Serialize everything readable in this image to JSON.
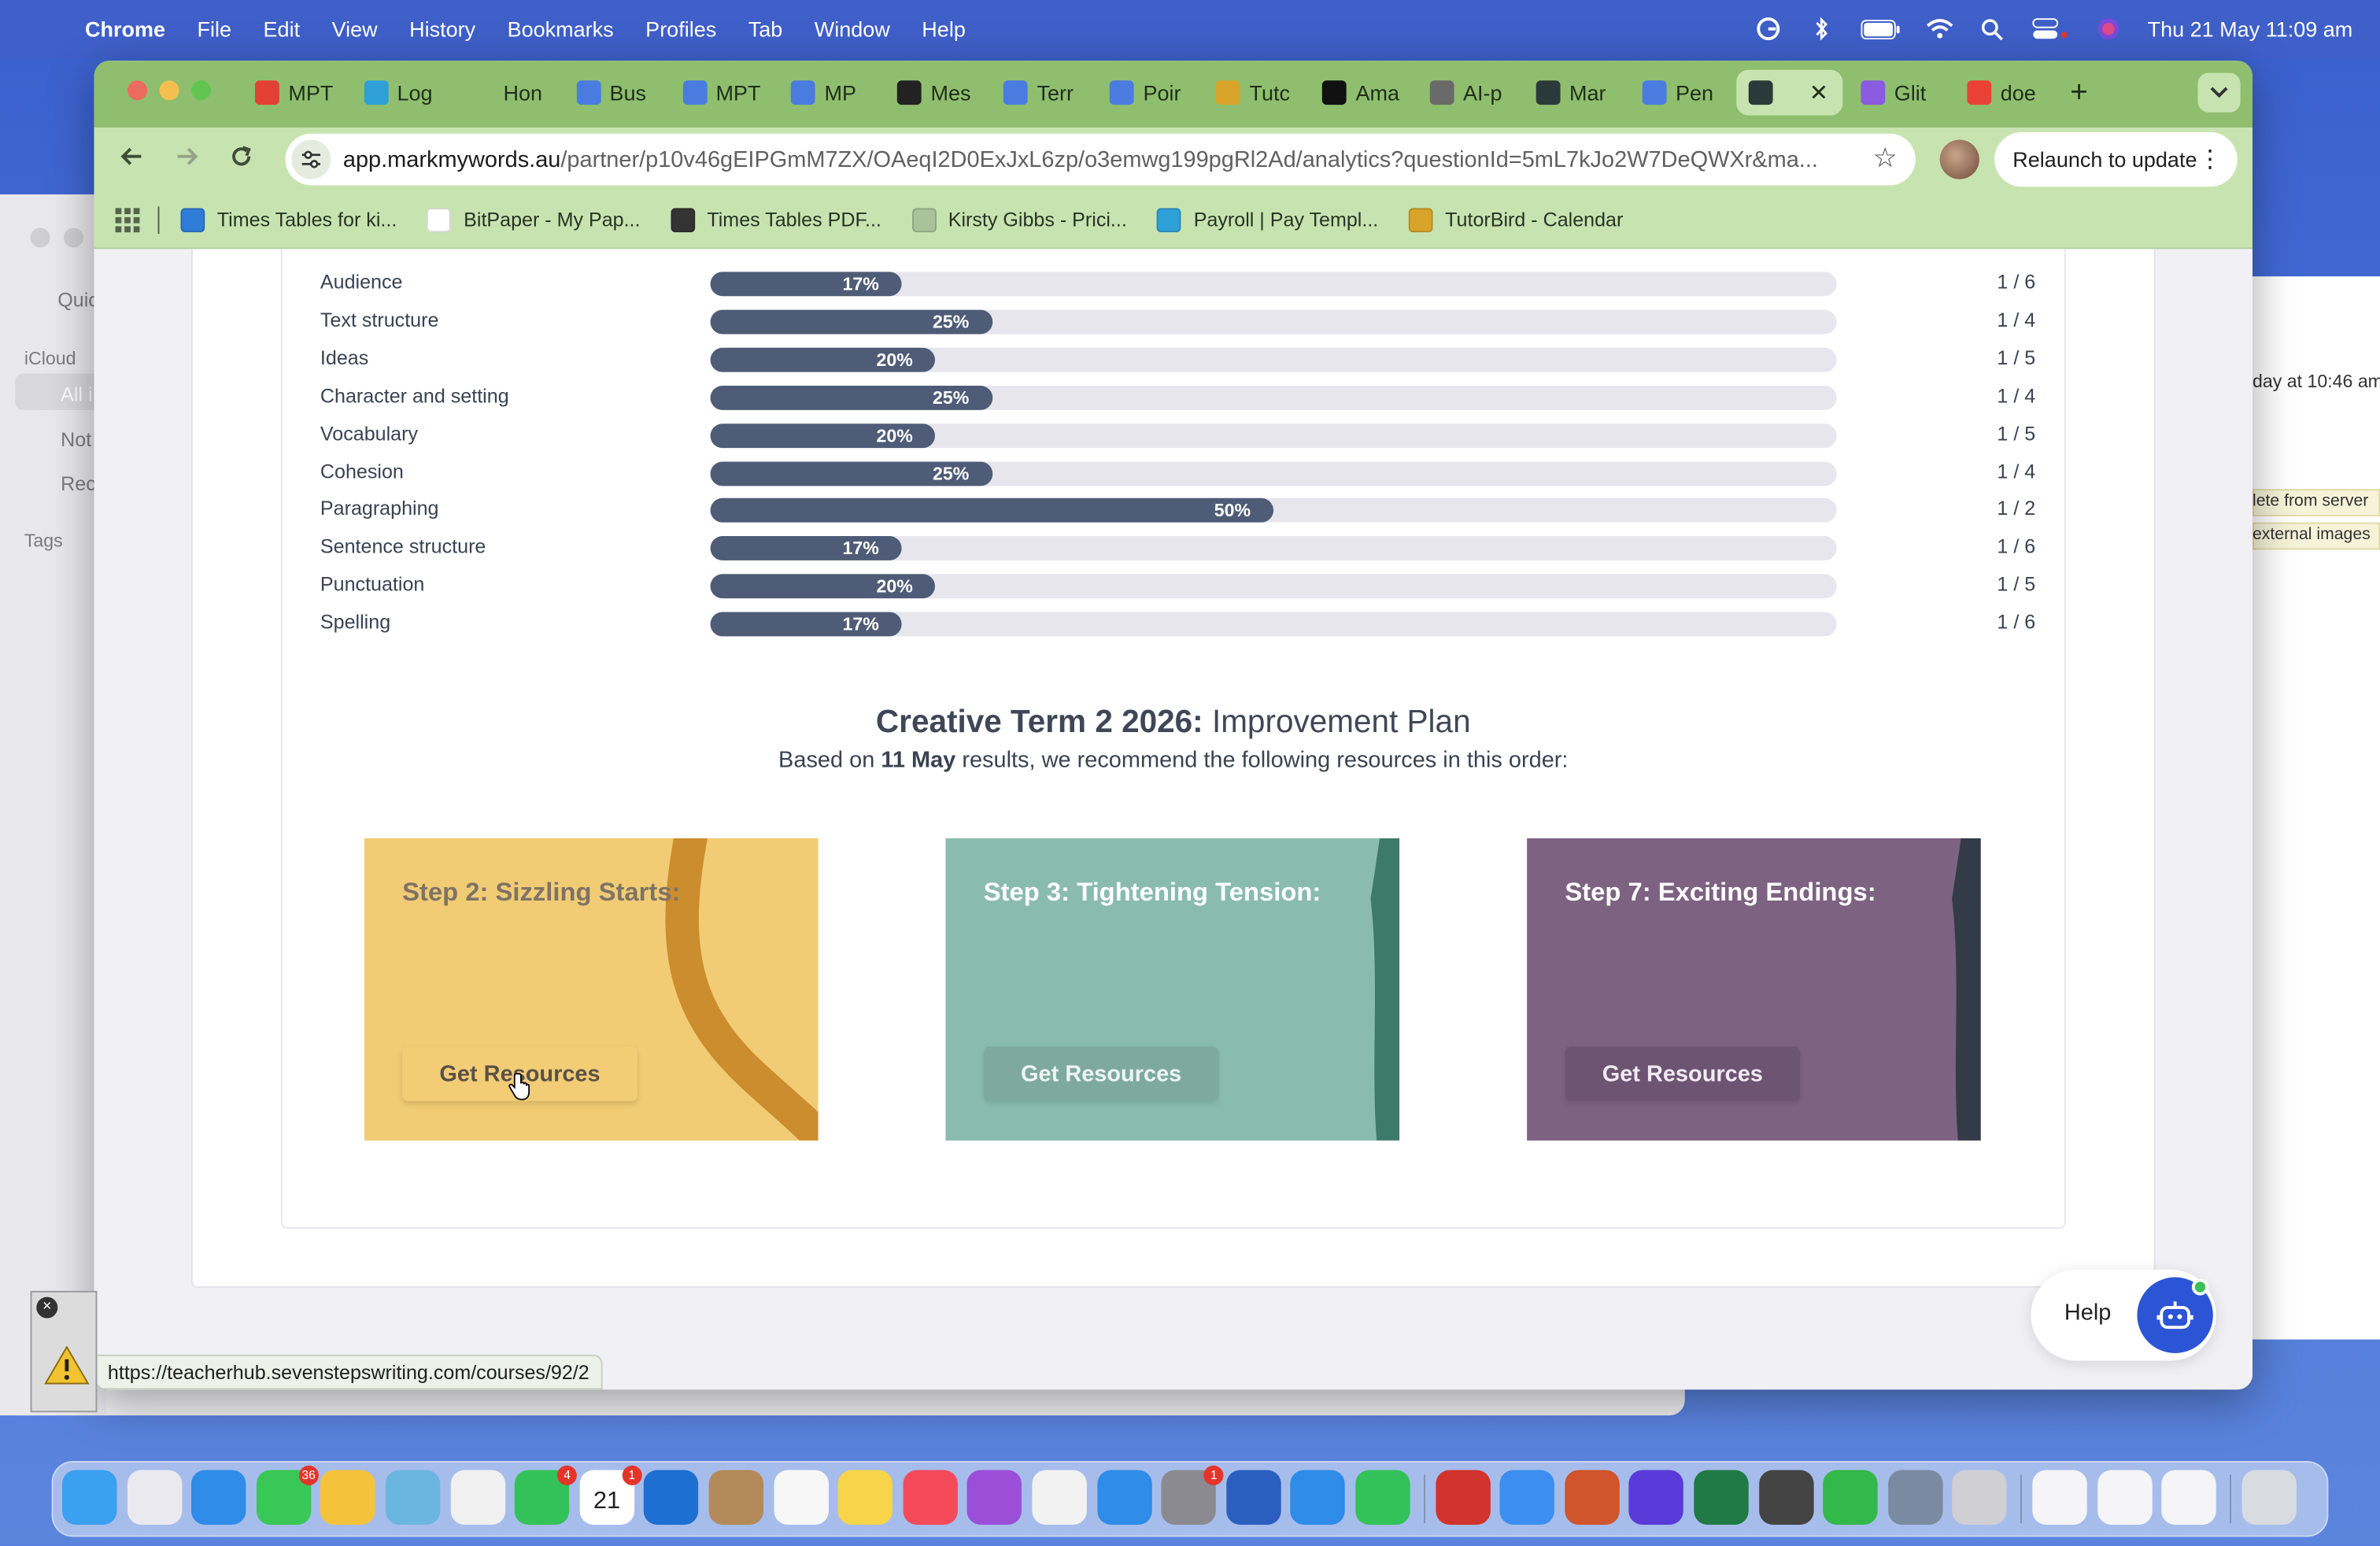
{
  "menubar": {
    "app": "Chrome",
    "items": [
      "File",
      "Edit",
      "View",
      "History",
      "Bookmarks",
      "Profiles",
      "Tab",
      "Window",
      "Help"
    ],
    "datetime": "Thu 21 May  11:09 am"
  },
  "background_window": {
    "sidebar_items": [
      "Quic",
      "iCloud",
      "All i",
      "Not",
      "Rec",
      "Tags"
    ],
    "right_text": [
      "day at 10:46 am",
      "lete from server",
      "external images"
    ]
  },
  "tabs": [
    {
      "label": "MPT",
      "color": "#e34133"
    },
    {
      "label": "Log",
      "color": "#2f9fd8"
    },
    {
      "label": "Hon",
      "color": "#8fbf6e"
    },
    {
      "label": "Bus",
      "color": "#4a7ce0"
    },
    {
      "label": "MPT",
      "color": "#4a7ce0"
    },
    {
      "label": "MP",
      "color": "#4a7ce0"
    },
    {
      "label": "Mes",
      "color": "#222222"
    },
    {
      "label": "Terr",
      "color": "#4a7ce0"
    },
    {
      "label": "Poir",
      "color": "#4a7ce0"
    },
    {
      "label": "Tutc",
      "color": "#d8a52a"
    },
    {
      "label": "Ama",
      "color": "#111111"
    },
    {
      "label": "AI-p",
      "color": "#6a6a6a"
    },
    {
      "label": "Mar",
      "color": "#2a3a3a"
    },
    {
      "label": "Pen",
      "color": "#4a7ce0"
    },
    {
      "label": "",
      "color": "#2a3a3a",
      "active": true
    },
    {
      "label": "Glit",
      "color": "#8a5ae0"
    },
    {
      "label": "doe",
      "color": "#ea4335"
    }
  ],
  "toolbar": {
    "url_domain": "app.markmywords.au",
    "url_path": "/partner/p10v46gEIPGmM7ZX/OAeqI2D0ExJxL6zp/o3emwg199pgRl2Ad/analytics?questionId=5mL7kJo2W7DeQWXr&ma...",
    "relaunch_label": "Relaunch to update"
  },
  "bookmarks": [
    {
      "label": "Times Tables for ki...",
      "color": "#2f7bd8"
    },
    {
      "label": "BitPaper - My Pap...",
      "color": "#ffffff"
    },
    {
      "label": "Times Tables PDF...",
      "color": "#333333"
    },
    {
      "label": "Kirsty Gibbs - Prici...",
      "color": "#a9c29a"
    },
    {
      "label": "Payroll | Pay Templ...",
      "color": "#2f9fd8"
    },
    {
      "label": "TutorBird - Calendar",
      "color": "#d8a52a"
    }
  ],
  "chart_data": {
    "type": "bar",
    "categories": [
      "Audience",
      "Text structure",
      "Ideas",
      "Character and setting",
      "Vocabulary",
      "Cohesion",
      "Paragraphing",
      "Sentence structure",
      "Punctuation",
      "Spelling"
    ],
    "values": [
      17,
      25,
      20,
      25,
      20,
      25,
      50,
      17,
      20,
      17
    ],
    "value_labels": [
      "17%",
      "25%",
      "20%",
      "25%",
      "20%",
      "25%",
      "50%",
      "17%",
      "20%",
      "17%"
    ],
    "ratios": [
      "1 / 6",
      "1 / 4",
      "1 / 5",
      "1 / 4",
      "1 / 5",
      "1 / 4",
      "1 / 2",
      "1 / 6",
      "1 / 5",
      "1 / 6"
    ],
    "xlim": [
      0,
      100
    ],
    "bar_color": "#4f5c77",
    "track_color": "#e6e6ec"
  },
  "plan": {
    "title_bold": "Creative Term 2 2026:",
    "title_rest": " Improvement Plan",
    "subtitle_pre": "Based on ",
    "subtitle_bold": "11 May",
    "subtitle_post": " results, we recommend the following resources in this order:"
  },
  "steps": [
    {
      "title": "Step 2: Sizzling Starts:",
      "button": "Get Resources",
      "color": "#f2cc74"
    },
    {
      "title": "Step 3: Tightening Tension:",
      "button": "Get Resources",
      "color": "#8abcad"
    },
    {
      "title": "Step 7: Exciting Endings:",
      "button": "Get Resources",
      "color": "#7d6282"
    }
  ],
  "help": {
    "label": "Help"
  },
  "status_url": "https://teacherhub.sevenstepswriting.com/courses/92/2",
  "dock": {
    "apps": [
      {
        "name": "finder",
        "color": "#3aa0f0"
      },
      {
        "name": "launchpad",
        "color": "#e9e9ef"
      },
      {
        "name": "safari",
        "color": "#2f8ce8"
      },
      {
        "name": "messages",
        "color": "#39c857",
        "badge": "36"
      },
      {
        "name": "chrome",
        "color": "#f5c33b"
      },
      {
        "name": "maps",
        "color": "#6ab6e0"
      },
      {
        "name": "photos",
        "color": "#f0f0f0"
      },
      {
        "name": "facetime",
        "color": "#33c259",
        "badge": "4"
      },
      {
        "name": "calendar",
        "color": "#ffffff",
        "badge": "1",
        "text": "21"
      },
      {
        "name": "outlook",
        "color": "#1d6fd1"
      },
      {
        "name": "contacts",
        "color": "#b58a5a"
      },
      {
        "name": "reminders",
        "color": "#f7f7f7"
      },
      {
        "name": "notes",
        "color": "#f7d44a"
      },
      {
        "name": "music",
        "color": "#f44a5a"
      },
      {
        "name": "podcasts",
        "color": "#9b4fd8"
      },
      {
        "name": "news",
        "color": "#f2f2f2"
      },
      {
        "name": "app-store",
        "color": "#2f8ce8"
      },
      {
        "name": "system-settings",
        "color": "#8a8a90",
        "badge": "1"
      },
      {
        "name": "word",
        "color": "#2b5fbf"
      },
      {
        "name": "calendar-outlook",
        "color": "#2f8ce8"
      },
      {
        "name": "whatsapp",
        "color": "#33c259"
      },
      {
        "name": "acrobat",
        "color": "#d0342c"
      },
      {
        "name": "mail",
        "color": "#3c8ef0"
      },
      {
        "name": "powerpoint",
        "color": "#d0542c"
      },
      {
        "name": "grammarly",
        "color": "#5a3ad8"
      },
      {
        "name": "excel",
        "color": "#1f7a45"
      },
      {
        "name": "keychain",
        "color": "#444444"
      },
      {
        "name": "numbers",
        "color": "#33b84a"
      },
      {
        "name": "preview",
        "color": "#7a8aa0"
      },
      {
        "name": "printer",
        "color": "#cfcfd4"
      },
      {
        "name": "doc-1",
        "color": "#f5f5f7"
      },
      {
        "name": "doc-2",
        "color": "#f5f5f7"
      },
      {
        "name": "doc-3",
        "color": "#f5f5f7"
      },
      {
        "name": "trash",
        "color": "#d8dbe0"
      }
    ]
  }
}
